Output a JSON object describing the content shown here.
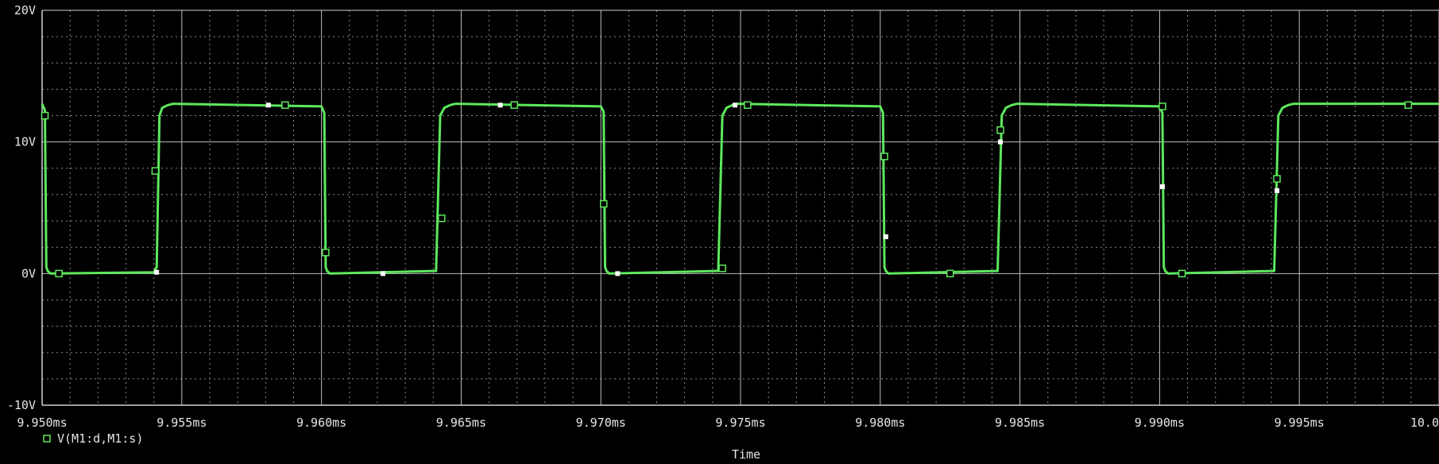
{
  "chart_data": {
    "type": "line",
    "x_unit": "ms",
    "y_unit": "V",
    "xlabel": "Time",
    "ylabel": "",
    "xlim": [
      9.95,
      10.0
    ],
    "ylim": [
      -10,
      20
    ],
    "grid": true,
    "background": "#000000",
    "trace_color": "#5de85d",
    "x_ticks": [
      9.95,
      9.955,
      9.96,
      9.965,
      9.97,
      9.975,
      9.98,
      9.985,
      9.99,
      9.995,
      10.0
    ],
    "x_tick_labels": [
      "9.950ms",
      "9.955ms",
      "9.960ms",
      "9.965ms",
      "9.970ms",
      "9.975ms",
      "9.980ms",
      "9.985ms",
      "9.990ms",
      "9.995ms",
      "10.000ms"
    ],
    "y_ticks": [
      -10,
      0,
      10,
      20
    ],
    "y_tick_labels": [
      "-10V",
      "0V",
      "10V",
      "20V"
    ],
    "legend_position": "bottom-left",
    "series": [
      {
        "name": "V(M1:d,M1:s)",
        "marker": "square",
        "x": [
          9.95,
          9.9501,
          9.95015,
          9.9502,
          9.9503,
          9.954,
          9.9541,
          9.9542,
          9.9543,
          9.9545,
          9.9547,
          9.96,
          9.9601,
          9.96015,
          9.9602,
          9.9603,
          9.9641,
          9.96415,
          9.96425,
          9.9644,
          9.9646,
          9.9648,
          9.97,
          9.9701,
          9.97015,
          9.9702,
          9.9703,
          9.9742,
          9.97425,
          9.97435,
          9.9745,
          9.9747,
          9.9749,
          9.98,
          9.9801,
          9.98015,
          9.9802,
          9.9803,
          9.9842,
          9.98425,
          9.98435,
          9.9845,
          9.9847,
          9.9849,
          9.99,
          9.9901,
          9.99015,
          9.9902,
          9.9903,
          9.9941,
          9.99415,
          9.99425,
          9.9944,
          9.9946,
          9.9948,
          10.0
        ],
        "y": [
          12.9,
          12.4,
          0.5,
          0.2,
          0.0,
          0.1,
          0.5,
          12.0,
          12.6,
          12.8,
          12.9,
          12.7,
          12.2,
          0.5,
          0.2,
          0.0,
          0.2,
          4.0,
          12.0,
          12.6,
          12.8,
          12.9,
          12.7,
          12.3,
          0.5,
          0.2,
          0.0,
          0.2,
          4.0,
          12.0,
          12.6,
          12.8,
          12.9,
          12.7,
          12.2,
          0.5,
          0.2,
          0.0,
          0.2,
          4.0,
          12.0,
          12.6,
          12.8,
          12.9,
          12.7,
          12.2,
          0.5,
          0.2,
          0.0,
          0.2,
          4.0,
          12.0,
          12.6,
          12.8,
          12.9,
          12.9
        ]
      }
    ],
    "markers": {
      "series_squares": [
        [
          9.9501,
          12.0
        ],
        [
          9.9506,
          0.0
        ],
        [
          9.95405,
          7.8
        ],
        [
          9.9587,
          12.8
        ],
        [
          9.96015,
          1.6
        ],
        [
          9.9643,
          4.2
        ],
        [
          9.9669,
          12.8
        ],
        [
          9.9701,
          5.3
        ],
        [
          9.97435,
          0.4
        ],
        [
          9.97525,
          12.8
        ],
        [
          9.98015,
          8.9
        ],
        [
          9.9825,
          0.0
        ],
        [
          9.9843,
          10.9
        ],
        [
          9.9901,
          12.7
        ],
        [
          9.9908,
          0.0
        ],
        [
          9.9942,
          7.2
        ],
        [
          9.9989,
          12.8
        ]
      ],
      "cursor_points": [
        [
          9.9541,
          0.1
        ],
        [
          9.9581,
          12.8
        ],
        [
          9.9622,
          0.0
        ],
        [
          9.9664,
          12.8
        ],
        [
          9.9706,
          0.0
        ],
        [
          9.9748,
          12.8
        ],
        [
          9.9802,
          2.8
        ],
        [
          9.9843,
          10.0
        ],
        [
          9.9901,
          6.6
        ],
        [
          9.9942,
          6.3
        ]
      ]
    }
  }
}
